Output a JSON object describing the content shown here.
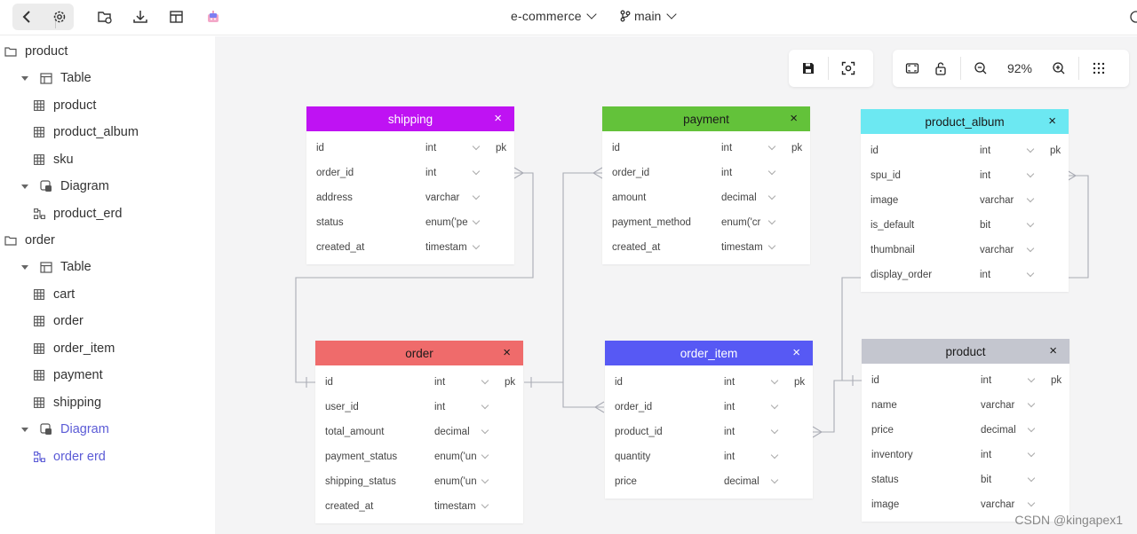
{
  "header": {
    "project": "e-commerce",
    "branch": "main"
  },
  "sidebar": {
    "groups": [
      {
        "label": "product",
        "table_folder": "Table",
        "tables": [
          "product",
          "product_album",
          "sku"
        ],
        "diagram_folder": "Diagram",
        "diagrams": [
          "product_erd"
        ]
      },
      {
        "label": "order",
        "table_folder": "Table",
        "tables": [
          "cart",
          "order",
          "order_item",
          "payment",
          "shipping"
        ],
        "diagram_folder": "Diagram",
        "diagrams": [
          "order erd"
        ]
      }
    ]
  },
  "zoom": "92%",
  "tables": {
    "shipping": {
      "title": "shipping",
      "color": "#bf12f3",
      "text_color": "#ffffff",
      "fields": [
        [
          "id",
          "int",
          "pk"
        ],
        [
          "order_id",
          "int",
          ""
        ],
        [
          "address",
          "varchar",
          ""
        ],
        [
          "status",
          "enum('pe",
          ""
        ],
        [
          "created_at",
          "timestam",
          ""
        ]
      ]
    },
    "payment": {
      "title": "payment",
      "color": "#63c23a",
      "text_color": "#1a1a1a",
      "fields": [
        [
          "id",
          "int",
          "pk"
        ],
        [
          "order_id",
          "int",
          ""
        ],
        [
          "amount",
          "decimal",
          ""
        ],
        [
          "payment_method",
          "enum('cr",
          ""
        ],
        [
          "created_at",
          "timestam",
          ""
        ]
      ]
    },
    "product_album": {
      "title": "product_album",
      "color": "#6ce8f2",
      "text_color": "#1a1a1a",
      "fields": [
        [
          "id",
          "int",
          "pk"
        ],
        [
          "spu_id",
          "int",
          ""
        ],
        [
          "image",
          "varchar",
          ""
        ],
        [
          "is_default",
          "bit",
          ""
        ],
        [
          "thumbnail",
          "varchar",
          ""
        ],
        [
          "display_order",
          "int",
          ""
        ]
      ]
    },
    "order": {
      "title": "order",
      "color": "#ef6b6b",
      "text_color": "#1a1a1a",
      "fields": [
        [
          "id",
          "int",
          "pk"
        ],
        [
          "user_id",
          "int",
          ""
        ],
        [
          "total_amount",
          "decimal",
          ""
        ],
        [
          "payment_status",
          "enum('un",
          ""
        ],
        [
          "shipping_status",
          "enum('un",
          ""
        ],
        [
          "created_at",
          "timestam",
          ""
        ]
      ]
    },
    "order_item": {
      "title": "order_item",
      "color": "#5759f4",
      "text_color": "#ffffff",
      "fields": [
        [
          "id",
          "int",
          "pk"
        ],
        [
          "order_id",
          "int",
          ""
        ],
        [
          "product_id",
          "int",
          ""
        ],
        [
          "quantity",
          "int",
          ""
        ],
        [
          "price",
          "decimal",
          ""
        ]
      ]
    },
    "product": {
      "title": "product",
      "color": "#c4c6cf",
      "text_color": "#1a1a1a",
      "fields": [
        [
          "id",
          "int",
          "pk"
        ],
        [
          "name",
          "varchar",
          ""
        ],
        [
          "price",
          "decimal",
          ""
        ],
        [
          "inventory",
          "int",
          ""
        ],
        [
          "status",
          "bit",
          ""
        ],
        [
          "image",
          "varchar",
          ""
        ]
      ]
    }
  },
  "close_glyph": "×",
  "watermark": "CSDN @kingapex1"
}
